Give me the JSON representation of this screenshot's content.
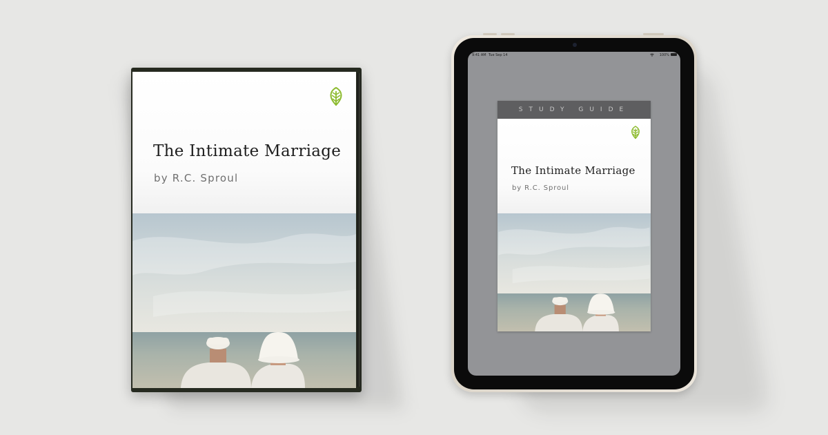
{
  "dvd": {
    "title": "The Intimate Marriage",
    "author": "by R.C. Sproul"
  },
  "ipad": {
    "status_time": "9:41 AM",
    "status_date": "Tue Sep 14",
    "battery_text": "100%",
    "book": {
      "band_label": "STUDY GUIDE",
      "title": "The Intimate Marriage",
      "author": "by R.C. Sproul"
    }
  },
  "colors": {
    "background": "#e7e7e5",
    "logo_green": "#8dbb2f",
    "case": "#262a20",
    "screen": "#939497"
  },
  "icons": {
    "publisher_logo": "tree-leaf-icon",
    "wifi": "wifi-icon",
    "battery": "battery-icon"
  }
}
